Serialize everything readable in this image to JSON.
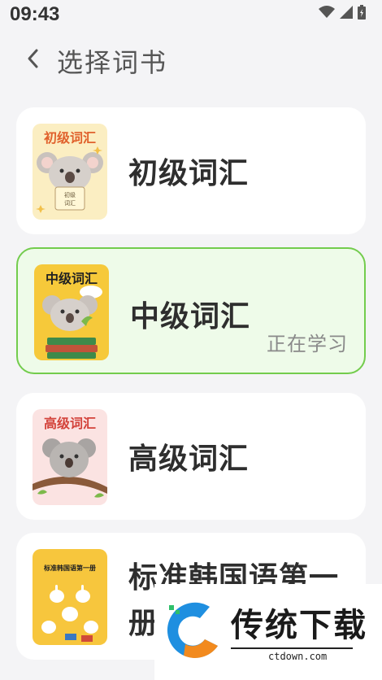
{
  "status_bar": {
    "time": "09:43"
  },
  "header": {
    "title": "选择词书"
  },
  "books": [
    {
      "cover_title": "初级词汇",
      "title": "初级词汇",
      "cover_text": "初级\n词汇"
    },
    {
      "cover_title": "中级词汇",
      "title": "中级词汇",
      "badge": "正在学习"
    },
    {
      "cover_title": "高级词汇",
      "title": "高级词汇"
    },
    {
      "cover_title": "标准韩国语第一册",
      "cover_small": "标准韩国语第一册",
      "title": "标准韩国语第一册"
    }
  ],
  "watermark": {
    "brand": "传统下载",
    "url": "ctdown.com"
  },
  "colors": {
    "active_border": "#73cc4d",
    "active_bg": "#eefbe9",
    "page_bg": "#f4f4f6"
  }
}
